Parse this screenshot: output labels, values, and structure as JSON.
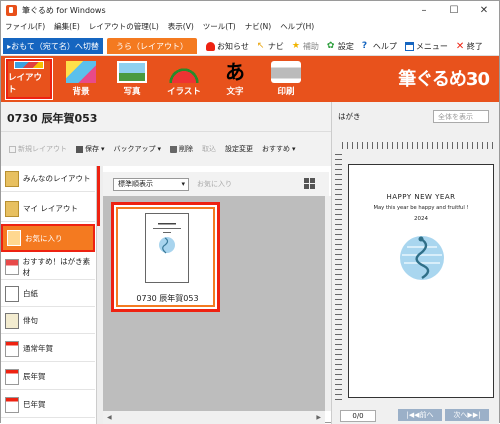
{
  "window": {
    "title": "筆ぐるめ for Windows",
    "controls": [
      "–",
      "☐",
      "✕"
    ]
  },
  "menu": [
    "ファイル(F)",
    "編集(E)",
    "レイアウトの管理(L)",
    "表示(V)",
    "ツール(T)",
    "ナビ(N)",
    "ヘルプ(H)"
  ],
  "mode_tabs": {
    "omote": "▸おもて（宛て名）へ切替",
    "ura": "うら（レイアウト）"
  },
  "quick_links": [
    {
      "label": "お知らせ",
      "icon": "bell-icon"
    },
    {
      "label": "ナビ",
      "icon": "pointer-icon"
    },
    {
      "label": "補助",
      "icon": "star-icon"
    },
    {
      "label": "設定",
      "icon": "gear-icon"
    },
    {
      "label": "ヘルプ",
      "icon": "question-icon"
    },
    {
      "label": "メニュー",
      "icon": "menu-icon"
    },
    {
      "label": "終了",
      "icon": "close-icon"
    }
  ],
  "toolbar": {
    "layout": "レイアウト",
    "background": "背景",
    "photo": "写真",
    "illust": "イラスト",
    "text": "文字",
    "print": "印刷"
  },
  "brand": "筆ぐるめ30",
  "document": {
    "title": "0730 辰年賀053"
  },
  "actions": {
    "new_layout": "新規レイアウト",
    "save": "保存",
    "backup": "バックアップ",
    "delete": "削除",
    "retrieve": "取込",
    "change_settings": "設定変更",
    "recommend": "おすすめ"
  },
  "sidebar": {
    "items": [
      {
        "label": "みんなのレイアウト"
      },
      {
        "label": "マイ レイアウト"
      },
      {
        "label": "お気に入り"
      },
      {
        "label": "おすすめ！はがき素材"
      },
      {
        "label": "白紙"
      },
      {
        "label": "俳句"
      },
      {
        "label": "通常年賀"
      },
      {
        "label": "辰年賀"
      },
      {
        "label": "巳年賀"
      }
    ]
  },
  "gallery": {
    "sort": "標準順表示",
    "favorite": "お気に入り",
    "thumb_label": "0730 辰年賀053"
  },
  "preview": {
    "label": "はがき",
    "zoom": "全体を表示",
    "card_line1": "HAPPY NEW YEAR",
    "card_line2": "May this year be happy and fruitful !",
    "card_year": "2024",
    "page": "0/0",
    "prev": "|◀◀前へ",
    "next": "次へ▶▶|"
  },
  "colors": {
    "toolbar": "#e8521c",
    "accent": "#f47a20",
    "blue": "#1565c0",
    "highlight": "#e21"
  }
}
